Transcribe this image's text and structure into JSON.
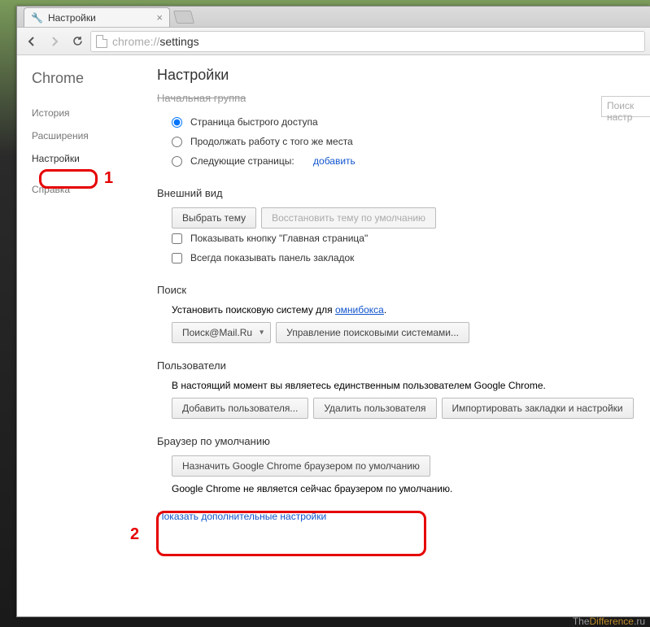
{
  "tab": {
    "title": "Настройки"
  },
  "url": {
    "proto": "chrome://",
    "path": "settings"
  },
  "sidebar": {
    "brand": "Chrome",
    "items": [
      {
        "label": "История"
      },
      {
        "label": "Расширения"
      },
      {
        "label": "Настройки"
      },
      {
        "label": "Справка"
      }
    ]
  },
  "page": {
    "title": "Настройки",
    "search_placeholder": "Поиск настр"
  },
  "startup": {
    "heading": "Начальная группа",
    "opt1": "Страница быстрого доступа",
    "opt2": "Продолжать работу с того же места",
    "opt3": "Следующие страницы:",
    "add": "добавить"
  },
  "appearance": {
    "heading": "Внешний вид",
    "choose_theme": "Выбрать тему",
    "reset_theme": "Восстановить тему по умолчанию",
    "show_home": "Показывать кнопку \"Главная страница\"",
    "always_bookmarks": "Всегда показывать панель закладок"
  },
  "search": {
    "heading": "Поиск",
    "desc_prefix": "Установить поисковую систему для ",
    "omnibox": "омнибокса",
    "engine": "Поиск@Mail.Ru",
    "manage": "Управление поисковыми системами..."
  },
  "users": {
    "heading": "Пользователи",
    "desc": "В настоящий момент вы являетесь единственным пользователем Google Chrome.",
    "add": "Добавить пользователя...",
    "remove": "Удалить пользователя",
    "import": "Импортировать закладки и настройки"
  },
  "default_browser": {
    "heading": "Браузер по умолчанию",
    "button": "Назначить Google Chrome браузером по умолчанию",
    "status": "Google Chrome не является сейчас браузером по умолчанию."
  },
  "advanced": "Показать дополнительные настройки",
  "annotations": {
    "one": "1",
    "two": "2"
  },
  "watermark": {
    "a": "The",
    "b": "Difference",
    "c": ".ru"
  }
}
